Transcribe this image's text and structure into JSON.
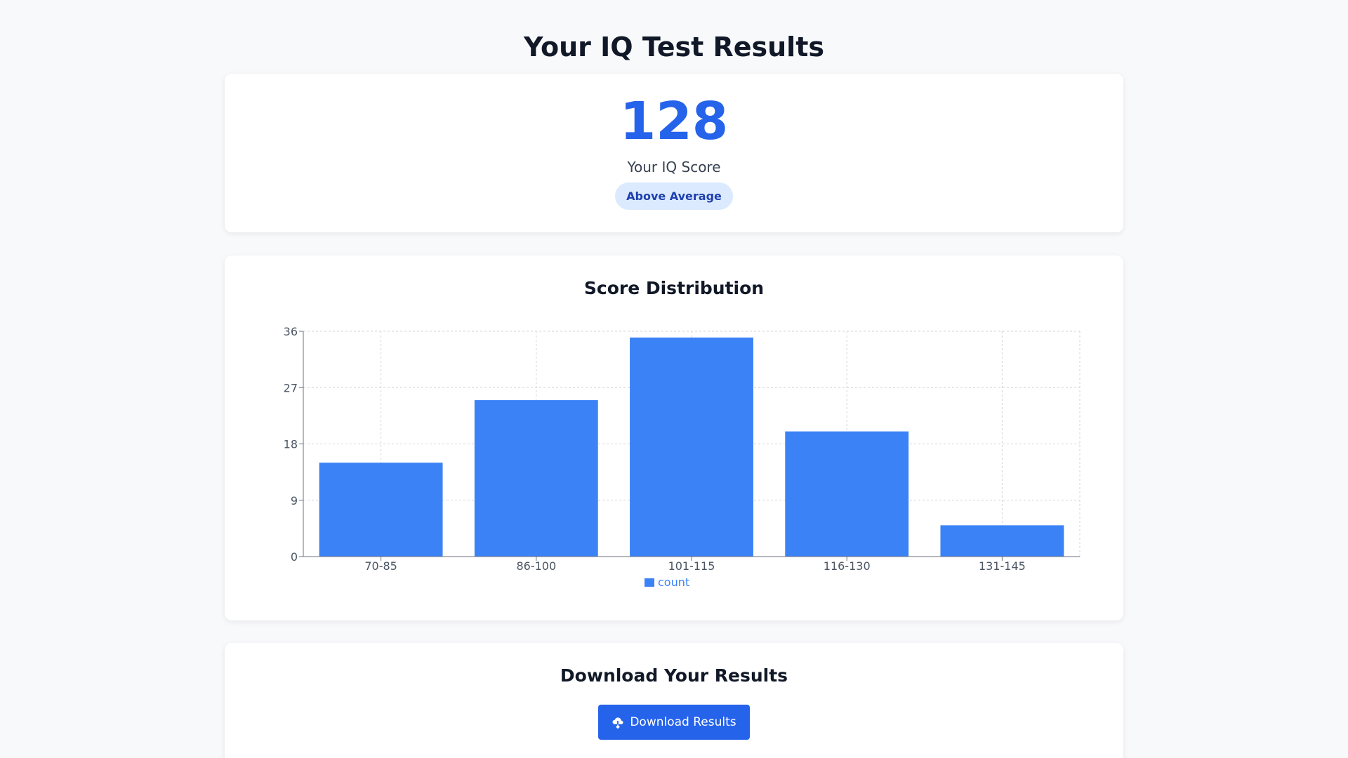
{
  "page": {
    "title": "Your IQ Test Results"
  },
  "score_card": {
    "score": "128",
    "label": "Your IQ Score",
    "badge": "Above Average"
  },
  "distribution": {
    "title": "Score Distribution"
  },
  "download": {
    "title": "Download Your Results",
    "button_label": "Download Results",
    "button_icon": "cloud-download-icon"
  },
  "colors": {
    "accent": "#2563eb",
    "bar": "#3b82f6",
    "badge_bg": "#dbeafe",
    "badge_text": "#1e40af"
  },
  "chart_data": {
    "type": "bar",
    "categories": [
      "70-85",
      "86-100",
      "101-115",
      "116-130",
      "131-145"
    ],
    "series": [
      {
        "name": "count",
        "values": [
          15,
          25,
          35,
          20,
          5
        ]
      }
    ],
    "yticks": [
      0,
      9,
      18,
      27,
      36
    ],
    "ylim": [
      0,
      36
    ],
    "grid": true,
    "legend": "bottom-center"
  }
}
